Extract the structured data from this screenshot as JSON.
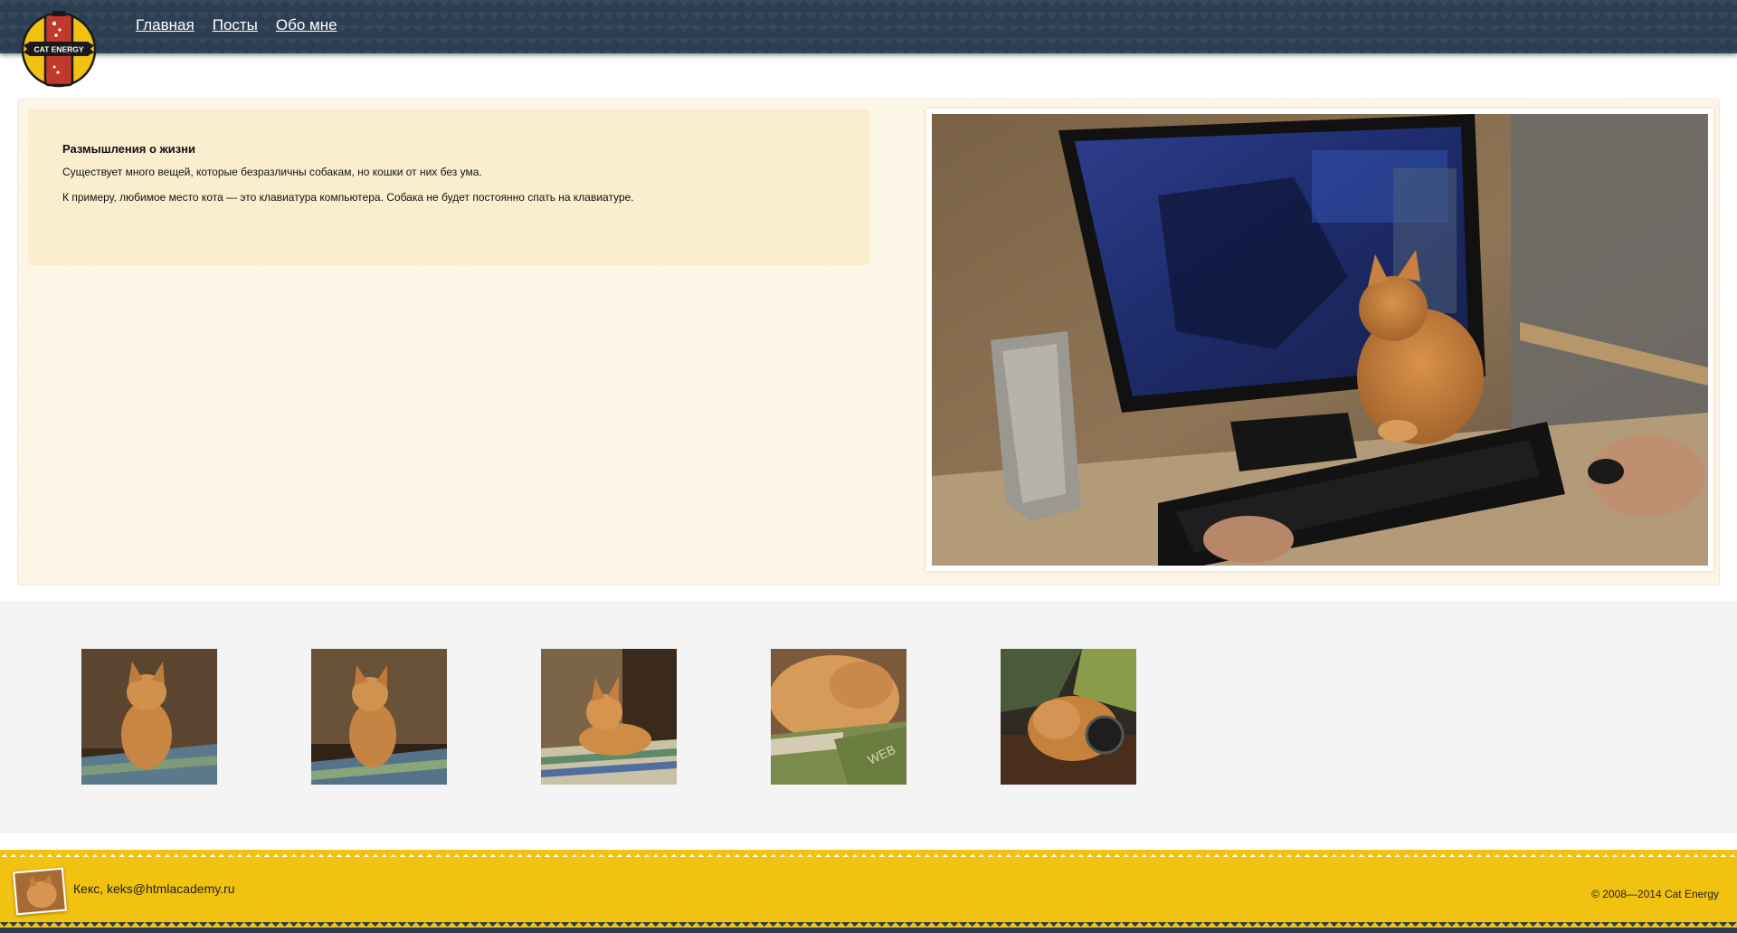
{
  "brand": {
    "logo_text": "CAT ENERGY"
  },
  "nav": {
    "items": [
      {
        "label": "Главная"
      },
      {
        "label": "Посты"
      },
      {
        "label": "Обо мне"
      }
    ]
  },
  "post": {
    "title": "Размышления о жизни",
    "paragraphs": [
      "Существует много вещей, которые безразличны собакам, но кошки от них без ума.",
      "К примеру, любимое место кота — это клавиатура компьютера. Собака не будет постоянно спать на клавиатуре."
    ]
  },
  "gallery": {
    "count": 5
  },
  "footer": {
    "author": "Кекс, keks@htmlacademy.ru",
    "copyright": "© 2008—2014 Cat Energy"
  },
  "colors": {
    "header_bg": "#2c3e52",
    "card_bg": "#fbeecf",
    "main_bg": "#fdf5e4",
    "footer_bg": "#f1c20f"
  }
}
